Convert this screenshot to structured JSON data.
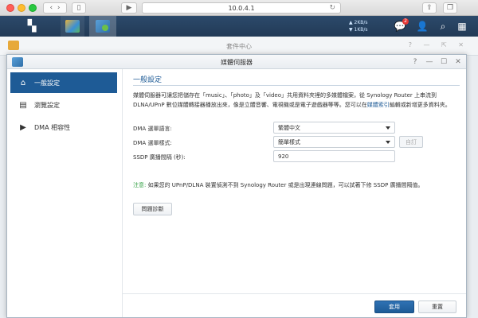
{
  "browser": {
    "url": "10.0.4.1"
  },
  "taskbar": {
    "net_up": "▲ 2KB/s",
    "net_down": "▼ 1KB/s",
    "notification_count": "2"
  },
  "background_window": {
    "title": "套件中心"
  },
  "window": {
    "title": "媒體伺服器"
  },
  "sidebar": {
    "items": [
      {
        "label": "一般設定",
        "icon": "home-icon",
        "active": true
      },
      {
        "label": "瀏覽設定",
        "icon": "browse-settings-icon",
        "active": false
      },
      {
        "label": "DMA 相容性",
        "icon": "play-icon",
        "active": false
      }
    ]
  },
  "content": {
    "section_title": "一般設定",
    "description_part1": "媒體伺服器可讓您把儲存在「music」、「photo」及「video」共用資料夾裡的多媒體檔案，從 Synology Router 上串流到 DLNA/UPnP 數位媒體轉接器播放出來，像是立體音響、電視機或是電子遊戲器等等。您可以在",
    "description_link": "媒體索引",
    "description_part2": "編輯或新增更多資料夾。",
    "form": {
      "dma_language_label": "DMA 選單語言:",
      "dma_language_value": "繁體中文",
      "dma_style_label": "DMA 選單樣式:",
      "dma_style_value": "簡單樣式",
      "custom_button": "自訂",
      "ssdp_label": "SSDP 廣播間隔 (秒):",
      "ssdp_value": "920"
    },
    "note_prefix": "注意:",
    "note_text": " 如果您的 UPnP/DLNA 裝置偵測不到 Synology Router 或是出現連線問題，可以試著下修 SSDP 廣播間隔值。",
    "diagnose_button": "問題診斷"
  },
  "footer": {
    "apply_label": "套用",
    "reset_label": "重置"
  }
}
